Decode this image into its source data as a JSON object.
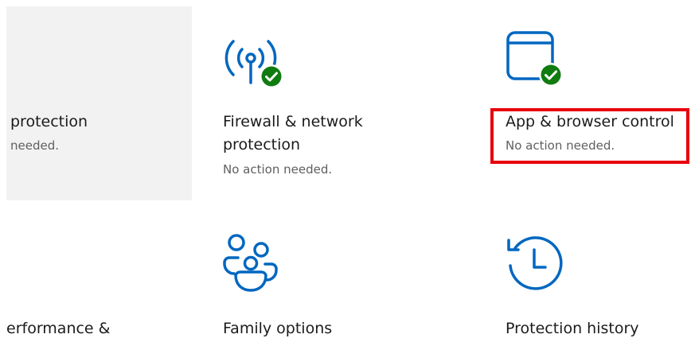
{
  "colors": {
    "accent": "#0067c0",
    "ok_green": "#107c10",
    "tile_selected_bg": "#f2f2f2",
    "highlight": "#e8000e"
  },
  "tiles": [
    {
      "id": "virus",
      "title": "protection",
      "status": "needed.",
      "icon": ""
    },
    {
      "id": "firewall",
      "title": "Firewall & network protection",
      "status": "No action needed.",
      "icon": "wifi-antenna-check-icon"
    },
    {
      "id": "app",
      "title": "App & browser control",
      "status": "No action needed.",
      "icon": "browser-window-check-icon"
    },
    {
      "id": "perf",
      "title": "erformance &",
      "status": "",
      "icon": ""
    },
    {
      "id": "family",
      "title": "Family options",
      "status": "",
      "icon": "family-group-icon"
    },
    {
      "id": "history",
      "title": "Protection history",
      "status": "",
      "icon": "history-clock-icon"
    }
  ]
}
